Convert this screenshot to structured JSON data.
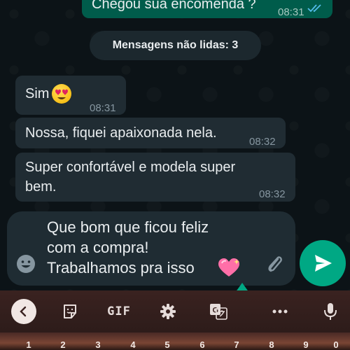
{
  "messages": {
    "top_outgoing": {
      "text": "Chegou sua encomenda ?",
      "time": "08:31"
    },
    "unread_banner": "Mensagens não lidas: 3",
    "incoming": [
      {
        "text": "Sim",
        "emoji": "heart-eyes-emoji",
        "time": "08:31"
      },
      {
        "text": "Nossa, fiquei apaixonada nela.",
        "time": "08:32"
      },
      {
        "text": "Super confortável e modela super bem.",
        "time": "08:32"
      }
    ]
  },
  "composer": {
    "text": "Que bom que ficou feliz\ncom a compra!\nTrabalhamos pra isso",
    "trailing_emoji": "sparkling-heart-emoji"
  },
  "keyboard": {
    "gif_label": "GIF",
    "number_row": [
      "1",
      "2",
      "3",
      "4",
      "5",
      "6",
      "7",
      "8",
      "9",
      "0"
    ]
  },
  "colors": {
    "outgoing_bubble": "#005c4b",
    "incoming_bubble": "#202c33",
    "send_button": "#00a884",
    "read_ticks": "#53bdeb"
  }
}
